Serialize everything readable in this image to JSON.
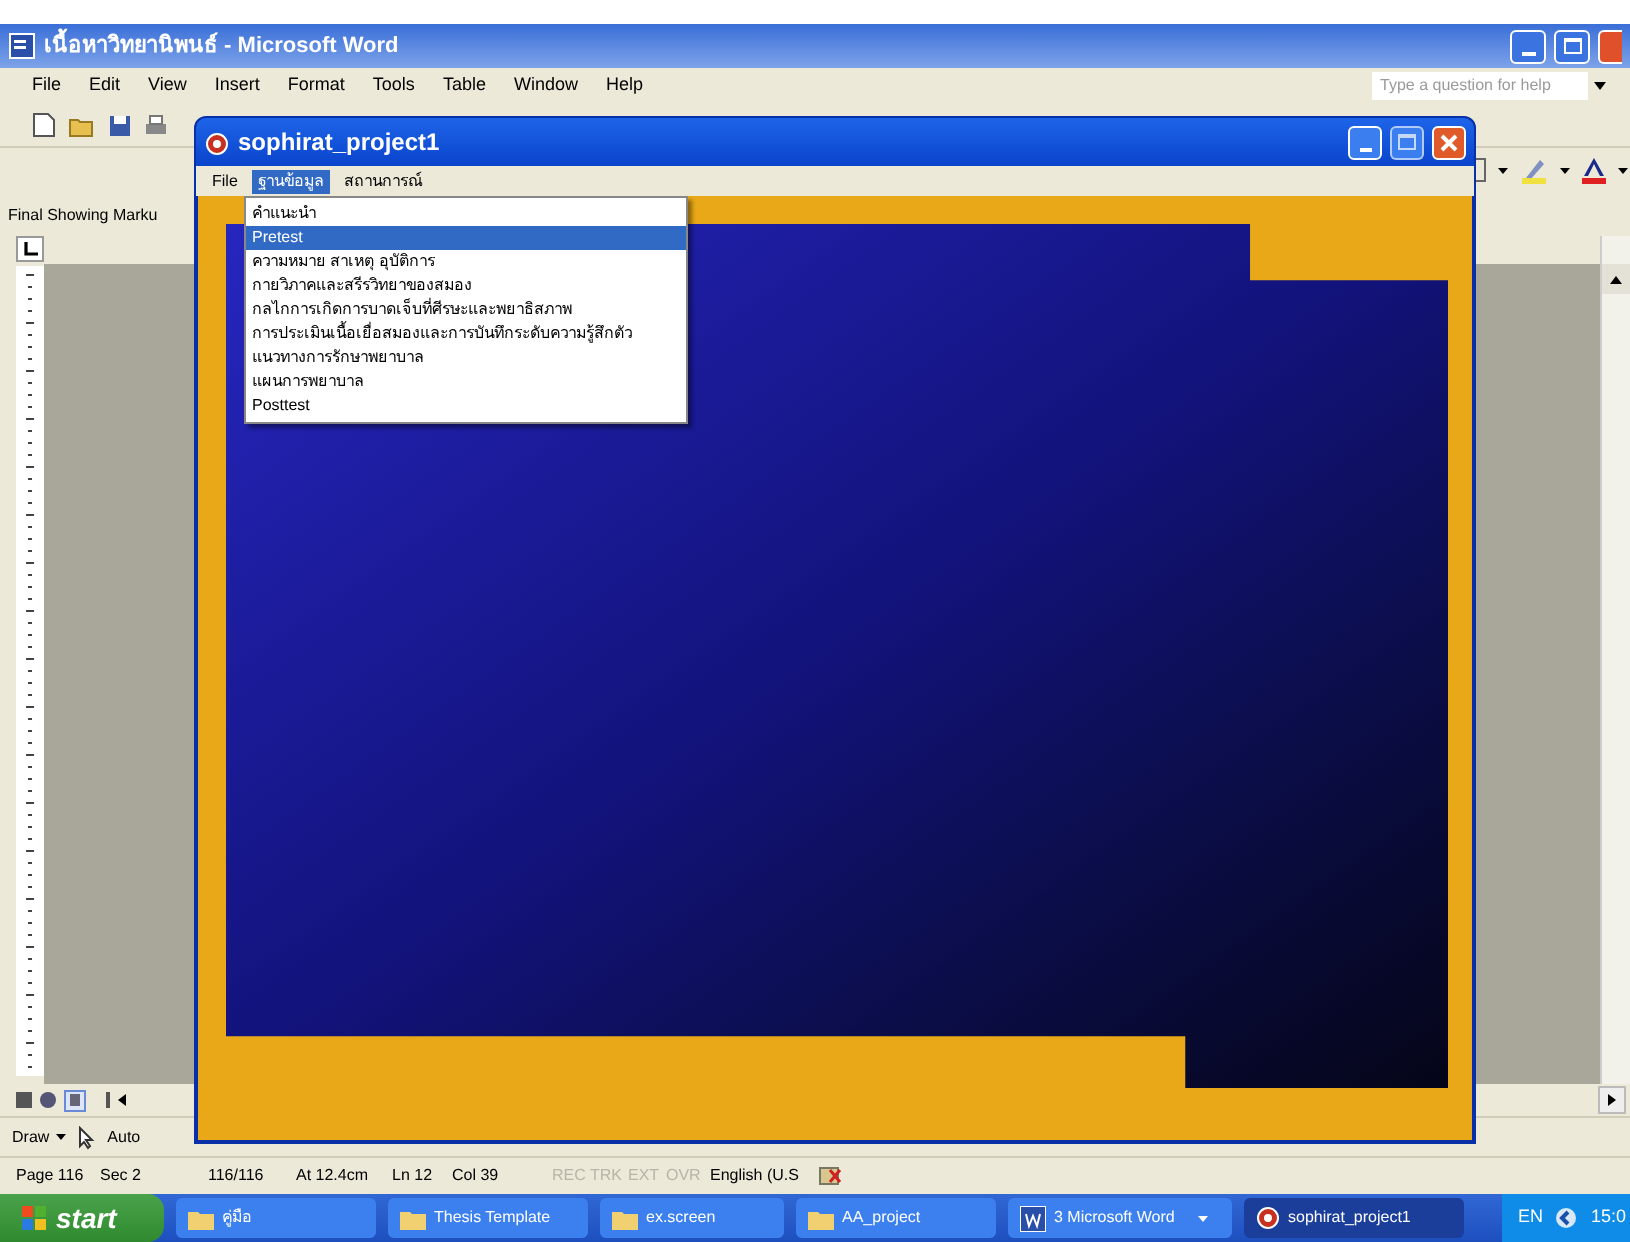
{
  "word_window": {
    "title": "เนื้อหาวิทยานิพนธ์ - Microsoft Word",
    "menu": [
      "File",
      "Edit",
      "View",
      "Insert",
      "Format",
      "Tools",
      "Table",
      "Window",
      "Help"
    ],
    "help_placeholder": "Type a question for help",
    "markup_dropdown": "Final Showing Marku",
    "draw_menu": "Draw",
    "autoshapes": "Auto",
    "status_bar": [
      {
        "text": "Page 116",
        "disabled": false
      },
      {
        "text": "Sec 2",
        "disabled": false
      },
      {
        "text": "116/116",
        "disabled": false
      },
      {
        "text": "At 12.4cm",
        "disabled": false
      },
      {
        "text": "Ln 12",
        "disabled": false
      },
      {
        "text": "Col 39",
        "disabled": false
      },
      {
        "text": "REC",
        "disabled": true
      },
      {
        "text": "TRK",
        "disabled": true
      },
      {
        "text": "EXT",
        "disabled": true
      },
      {
        "text": "OVR",
        "disabled": true
      },
      {
        "text": "English (U.S",
        "disabled": false
      }
    ]
  },
  "app_window": {
    "title": "sophirat_project1",
    "menu": [
      {
        "label": "File",
        "selected": false
      },
      {
        "label": "ฐานข้อมูล",
        "selected": true
      },
      {
        "label": "สถานการณ์",
        "selected": false
      }
    ],
    "dropdown": [
      {
        "label": "คำแนะนำ",
        "selected": false
      },
      {
        "label": "Pretest",
        "selected": true
      },
      {
        "label": "ความหมาย สาเหตุ อุบัติการ",
        "selected": false
      },
      {
        "label": "กายวิภาคและสรีรวิทยาของสมอง",
        "selected": false
      },
      {
        "label": "กลไกการเกิดการบาดเจ็บที่ศีรษะและพยาธิสภาพ",
        "selected": false
      },
      {
        "label": "การประเมินเนื้อเยื่อสมองและการบันทึกระดับความรู้สึกตัว",
        "selected": false
      },
      {
        "label": "แนวทางการรักษาพยาบาล",
        "selected": false
      },
      {
        "label": "แผนการพยาบาล",
        "selected": false
      },
      {
        "label": "Posttest",
        "selected": false
      }
    ]
  },
  "taskbar": {
    "start": "start",
    "buttons": [
      {
        "label": "คู่มือ",
        "kind": "folder",
        "selected": false
      },
      {
        "label": "Thesis Template",
        "kind": "folder",
        "selected": false
      },
      {
        "label": "ex.screen",
        "kind": "folder",
        "selected": false
      },
      {
        "label": "AA_project",
        "kind": "folder",
        "selected": false
      },
      {
        "label": "3 Microsoft Word",
        "kind": "word",
        "selected": false
      },
      {
        "label": "sophirat_project1",
        "kind": "app",
        "selected": true
      }
    ],
    "language": "EN",
    "clock": "15:0"
  }
}
